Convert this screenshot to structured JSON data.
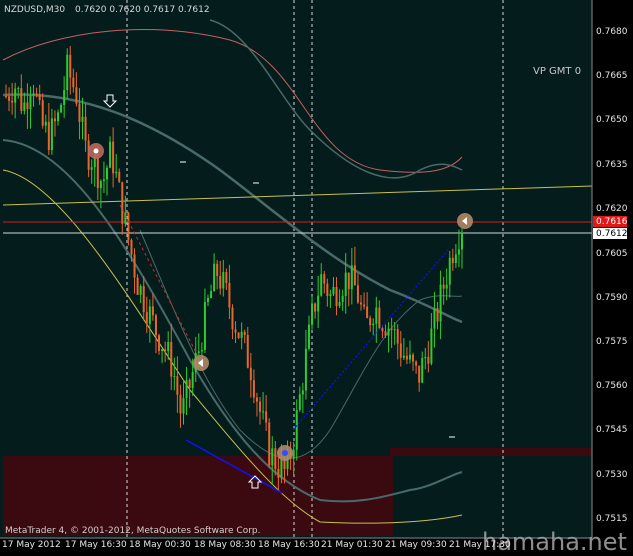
{
  "window": {
    "symbol_header": "NZDUSD,M30",
    "ohlc_header": "0.7620 0.7620 0.7617 0.7612",
    "indicator_label": "VP GMT 0",
    "copyright": "MetaTrader 4, © 2001-2012, MetaQuotes Software Corp.",
    "watermark": "hamaha.net"
  },
  "price_tags": {
    "red": "0.7616",
    "white": "0.7612"
  },
  "colors": {
    "background": "#041c1c",
    "bull_candle": "#2ecc2e",
    "bear_candle": "#e8682a",
    "zone": "#3b0a10",
    "grid_line": "#d8d8d8",
    "resistance": "#c8c050",
    "red_level": "#e01818",
    "trend_line": "#1010ff",
    "axis_text": "#e6e6e6"
  },
  "chart_data": {
    "type": "candlestick",
    "symbol": "NZDUSD",
    "timeframe": "M30",
    "y_ticks": [
      "0.7680",
      "0.7665",
      "0.7650",
      "0.7635",
      "0.7620",
      "0.7605",
      "0.7590",
      "0.7575",
      "0.7560",
      "0.7545",
      "0.7530",
      "0.7515"
    ],
    "x_ticks": [
      "17 May 2012",
      "17 May 16:30",
      "18 May 00:30",
      "18 May 08:30",
      "18 May 16:30",
      "21 May 01:30",
      "21 May 09:30",
      "21 May 17:30"
    ],
    "ylim": [
      0.751,
      0.7695
    ],
    "last_bid": 0.7612,
    "red_level": 0.7616,
    "session_separators": [
      "17 May 19:30",
      "18 May 19:30",
      "18 May 22:00",
      "21 May 02:00",
      "21 May 21:00"
    ],
    "approx_path": [
      0.7662,
      0.7666,
      0.7658,
      0.7669,
      0.7652,
      0.7648,
      0.7655,
      0.7671,
      0.7663,
      0.7644,
      0.764,
      0.7632,
      0.7643,
      0.7627,
      0.7612,
      0.7598,
      0.759,
      0.7582,
      0.7576,
      0.7569,
      0.7552,
      0.7563,
      0.7575,
      0.759,
      0.7602,
      0.7595,
      0.7585,
      0.7577,
      0.7568,
      0.7553,
      0.754,
      0.7535,
      0.7532,
      0.7548,
      0.7568,
      0.7588,
      0.76,
      0.7593,
      0.7597,
      0.76,
      0.7595,
      0.7582,
      0.759,
      0.7585,
      0.7582,
      0.7575,
      0.757,
      0.7565,
      0.7574,
      0.7585,
      0.7598,
      0.761,
      0.7618
    ]
  }
}
